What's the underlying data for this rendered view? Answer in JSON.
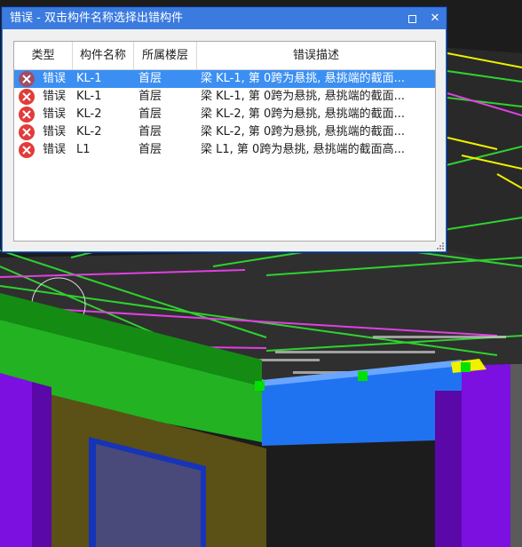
{
  "window": {
    "title": "错误 - 双击构件名称选择出错构件",
    "close_glyph": "✕",
    "restore_icon": "restore-icon",
    "close_icon": "close-icon"
  },
  "table": {
    "columns": [
      "类型",
      "构件名称",
      "所属楼层",
      "错误描述"
    ],
    "rows": [
      {
        "type": "错误",
        "name": "KL-1",
        "floor": "首层",
        "desc": "梁 KL-1, 第 0跨为悬挑, 悬挑端的截面...",
        "selected": true
      },
      {
        "type": "错误",
        "name": "KL-1",
        "floor": "首层",
        "desc": "梁 KL-1, 第 0跨为悬挑, 悬挑端的截面..."
      },
      {
        "type": "错误",
        "name": "KL-2",
        "floor": "首层",
        "desc": "梁 KL-2, 第 0跨为悬挑, 悬挑端的截面..."
      },
      {
        "type": "错误",
        "name": "KL-2",
        "floor": "首层",
        "desc": "梁 KL-2, 第 0跨为悬挑, 悬挑端的截面..."
      },
      {
        "type": "错误",
        "name": "L1",
        "floor": "首层",
        "desc": "梁 L1, 第 0跨为悬挑, 悬挑端的截面高..."
      }
    ]
  },
  "colors": {
    "titlebar": "#3b7be0",
    "selected_row": "#3b8ff2",
    "error_icon": "#e23b3b",
    "beam_green": "#1fb21f",
    "beam_blue": "#1f73f0",
    "column_purple": "#7b10e0",
    "wall_olive": "#5b5016",
    "slab_dark": "#2e2e2e",
    "magenta_line": "#e040e0",
    "yellow_line": "#f0f000"
  }
}
